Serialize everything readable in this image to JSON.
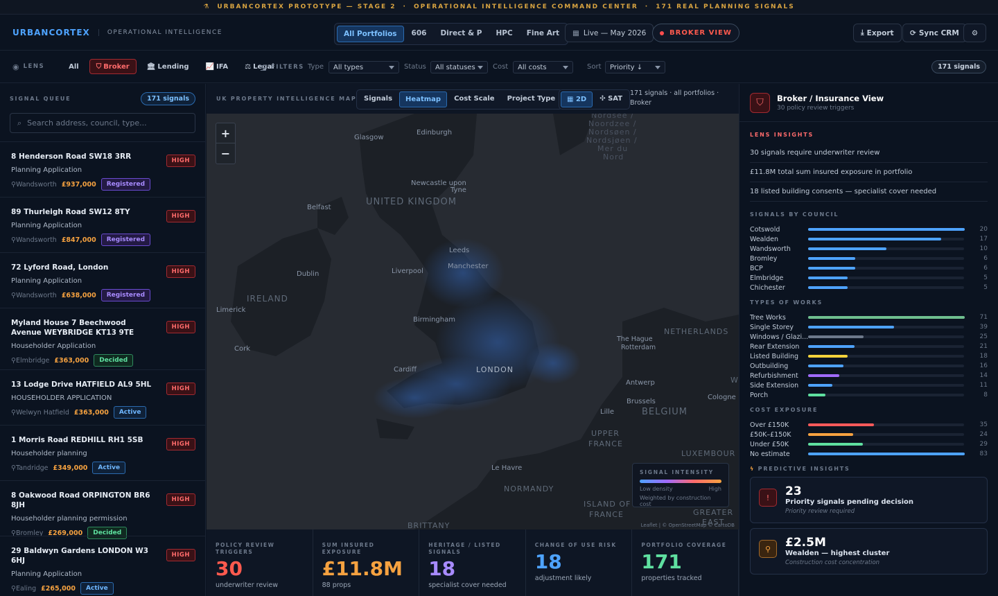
{
  "banner": {
    "icon": "flask-icon",
    "part1": "URBANCORTEX PROTOTYPE — STAGE 2",
    "sep1": "·",
    "part2": "OPERATIONAL INTELLIGENCE COMMAND CENTER",
    "sep2": "·",
    "part3": "171 REAL PLANNING SIGNALS"
  },
  "header": {
    "brand": "URBANCORTEX",
    "subtitle": "OPERATIONAL INTELLIGENCE",
    "tabs": [
      "All Portfolios",
      "606",
      "Direct & P",
      "HPC",
      "Fine Art"
    ],
    "live": "Live — May 2026",
    "broker_view": "BROKER VIEW",
    "export": "Export",
    "sync": "Sync CRM"
  },
  "lens": {
    "label": "LENS",
    "options": [
      "All",
      "Broker",
      "Lending",
      "IFA",
      "Legal"
    ]
  },
  "filters": {
    "label": "FILTERS",
    "type_label": "Type",
    "type_value": "All types",
    "status_label": "Status",
    "status_value": "All statuses",
    "cost_label": "Cost",
    "cost_value": "All costs",
    "sort_label": "Sort",
    "sort_value": "Priority ↓",
    "signals_badge": "171 signals"
  },
  "queue": {
    "title": "SIGNAL QUEUE",
    "badge": "171 signals",
    "search_placeholder": "Search address, council, type...",
    "high_label": "HIGH",
    "items": [
      {
        "address": "8 Henderson Road SW18 3RR",
        "type": "Planning Application",
        "council": "Wandsworth",
        "price": "£937,000",
        "status": "Registered"
      },
      {
        "address": "89 Thurleigh Road SW12 8TY",
        "type": "Planning Application",
        "council": "Wandsworth",
        "price": "£847,000",
        "status": "Registered"
      },
      {
        "address": "72 Lyford Road, London",
        "type": "Planning Application",
        "council": "Wandsworth",
        "price": "£638,000",
        "status": "Registered"
      },
      {
        "address": "Myland House 7 Beechwood Avenue WEYBRIDGE KT13 9TE",
        "type": "Householder Application",
        "council": "Elmbridge",
        "price": "£363,000",
        "status": "Decided"
      },
      {
        "address": "13 Lodge Drive HATFIELD AL9 5HL",
        "type": "HOUSEHOLDER APPLICATION",
        "council": "Welwyn Hatfield",
        "price": "£363,000",
        "status": "Active"
      },
      {
        "address": "1 Morris Road REDHILL RH1 5SB",
        "type": "Householder planning",
        "council": "Tandridge",
        "price": "£349,000",
        "status": "Active"
      },
      {
        "address": "8 Oakwood Road ORPINGTON BR6 8JH",
        "type": "Householder planning permission",
        "council": "Bromley",
        "price": "£269,000",
        "status": "Decided"
      },
      {
        "address": "29 Baldwyn Gardens LONDON W3 6HJ",
        "type": "Planning Application",
        "council": "Ealing",
        "price": "£265,000",
        "status": "Active"
      }
    ]
  },
  "map": {
    "title": "UK PROPERTY INTELLIGENCE MAP",
    "modes": [
      "Signals",
      "Heatmap",
      "Cost Scale",
      "Project Type"
    ],
    "view_2d": "2D",
    "view_sat": "SAT",
    "info_line1": "171 signals · all portfolios ·",
    "info_line2": "Broker",
    "zoom_in": "+",
    "zoom_out": "−",
    "labels": {
      "edinburgh": "Edinburgh",
      "glasgow": "Glasgow",
      "newcastle1": "Newcastle upon",
      "newcastle2": "Tyne",
      "uk": "UNITED KINGDOM",
      "belfast": "Belfast",
      "leeds": "Leeds",
      "manchester": "Manchester",
      "liverpool": "Liverpool",
      "dublin": "Dublin",
      "ireland": "IRELAND",
      "limerick": "Limerick",
      "birmingham": "Birmingham",
      "cork": "Cork",
      "cardiff": "Cardiff",
      "london": "LONDON",
      "thehague": "The Hague",
      "rotterdam": "Rotterdam",
      "netherlands": "NETHERLANDS",
      "antwerp": "Antwerp",
      "brussels": "Brussels",
      "cologne": "Cologne",
      "lille": "Lille",
      "belgium": "BELGIUM",
      "upperfrance1": "UPPER",
      "upperfrance2": "FRANCE",
      "luxembourg": "LUXEMBOUR",
      "lehavre": "Le Havre",
      "normandy": "NORMANDY",
      "iledefrance1": "ISLAND OF",
      "iledefrance2": "FRANCE",
      "greater1": "GREATER",
      "greater2": "EAST",
      "brittany": "BRITTANY",
      "w": "W",
      "sea1": "Nordsee /",
      "sea2": "Noordzee /",
      "sea3": "Nordsøen /",
      "sea4": "Nordsjøen /",
      "sea5": "Mer du",
      "sea6": "Nord"
    },
    "legend": {
      "title": "SIGNAL INTENSITY",
      "low": "Low density",
      "high": "High",
      "note": "Weighted by construction cost"
    },
    "attribution": "Leaflet | © OpenStreetMap © CartoDB"
  },
  "stats": [
    {
      "label": "POLICY REVIEW TRIGGERS",
      "value": "30",
      "sub": "underwriter review",
      "color": "#ff5a4e"
    },
    {
      "label": "SUM INSURED EXPOSURE",
      "value": "£11.8M",
      "sub": "88 props",
      "color": "#f6a240"
    },
    {
      "label": "HERITAGE / LISTED SIGNALS",
      "value": "18",
      "sub": "specialist cover needed",
      "color": "#a88bff"
    },
    {
      "label": "CHANGE OF USE RISK",
      "value": "18",
      "sub": "adjustment likely",
      "color": "#4ea3ff"
    },
    {
      "label": "PORTFOLIO COVERAGE",
      "value": "171",
      "sub": "properties tracked",
      "color": "#5fe0a0"
    }
  ],
  "panel": {
    "title": "Broker / Insurance View",
    "subtitle": "30 policy review triggers",
    "insights_title": "LENS INSIGHTS",
    "insights": [
      "30 signals require underwriter review",
      "£11.8M total sum insured exposure in portfolio",
      "18 listed building consents — specialist cover needed"
    ],
    "council_title": "SIGNALS BY COUNCIL",
    "councils": [
      {
        "name": "Cotswold",
        "count": 20
      },
      {
        "name": "Wealden",
        "count": 17
      },
      {
        "name": "Wandsworth",
        "count": 10
      },
      {
        "name": "Bromley",
        "count": 6
      },
      {
        "name": "BCP",
        "count": 6
      },
      {
        "name": "Elmbridge",
        "count": 5
      },
      {
        "name": "Chichester",
        "count": 5
      }
    ],
    "works_title": "TYPES OF WORKS",
    "works": [
      {
        "name": "Tree Works",
        "count": 71,
        "color": "#6fbf8f"
      },
      {
        "name": "Single Storey",
        "count": 39,
        "color": "#4ea3ff"
      },
      {
        "name": "Windows / Glazi...",
        "count": 25,
        "color": "#6d798b"
      },
      {
        "name": "Rear Extension",
        "count": 21,
        "color": "#4ea3ff"
      },
      {
        "name": "Listed Building",
        "count": 18,
        "color": "#f5d33b"
      },
      {
        "name": "Outbuilding",
        "count": 16,
        "color": "#4ea3ff"
      },
      {
        "name": "Refurbishment",
        "count": 14,
        "color": "#a06bff"
      },
      {
        "name": "Side Extension",
        "count": 11,
        "color": "#4ea3ff"
      },
      {
        "name": "Porch",
        "count": 8,
        "color": "#5fe0a0"
      }
    ],
    "cost_title": "COST EXPOSURE",
    "costs": [
      {
        "name": "Over £150K",
        "count": 35,
        "color": "#ff5a5a"
      },
      {
        "name": "£50K–£150K",
        "count": 24,
        "color": "#f6a240"
      },
      {
        "name": "Under £50K",
        "count": 29,
        "color": "#5fe0a0"
      },
      {
        "name": "No estimate",
        "count": 83,
        "color": "#4ea3ff"
      }
    ],
    "predictive_title": "PREDICTIVE INSIGHTS",
    "cards": [
      {
        "value": "23",
        "title": "Priority signals pending decision",
        "sub": "Priority review required",
        "icon": "alert-icon"
      },
      {
        "value": "£2.5M",
        "title": "Wealden — highest cluster",
        "sub": "Construction cost concentration",
        "icon": "location-pin-icon"
      }
    ]
  }
}
